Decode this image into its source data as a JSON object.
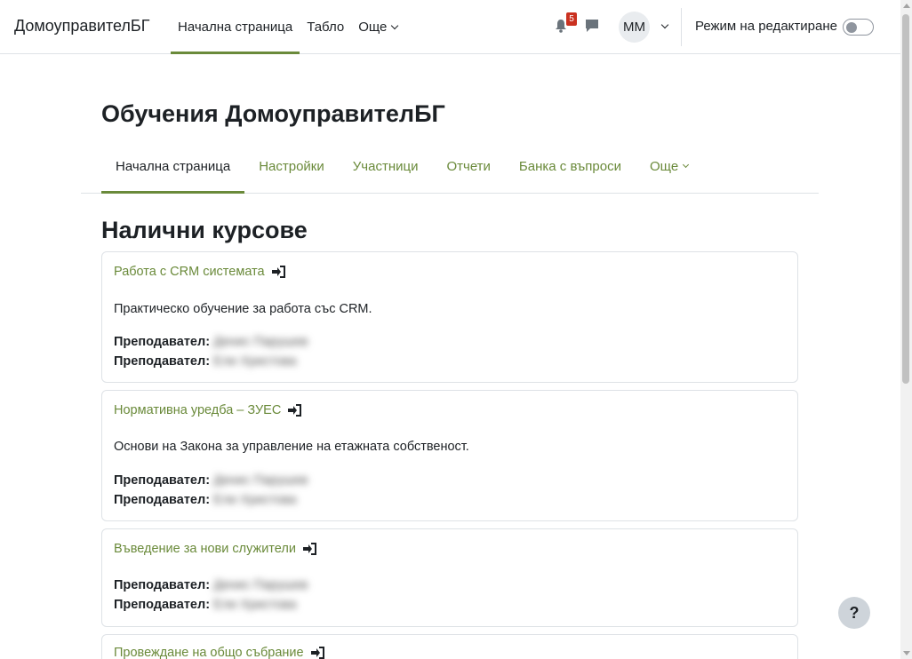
{
  "navbar": {
    "brand": "ДомоуправителБГ",
    "items": [
      {
        "label": "Начална страница",
        "active": true
      },
      {
        "label": "Табло",
        "active": false
      },
      {
        "label": "Още",
        "active": false
      }
    ],
    "notification_count": "5",
    "avatar_initials": "ММ",
    "edit_mode_label": "Режим на редактиране",
    "edit_mode_on": false
  },
  "site": {
    "title": "Обучения ДомоуправителБГ"
  },
  "secondary_nav": {
    "items": [
      {
        "label": "Начална страница",
        "active": true
      },
      {
        "label": "Настройки",
        "active": false
      },
      {
        "label": "Участници",
        "active": false
      },
      {
        "label": "Отчети",
        "active": false
      },
      {
        "label": "Банка с въпроси",
        "active": false
      },
      {
        "label": "Още",
        "active": false
      }
    ]
  },
  "courses_section": {
    "title": "Налични курсове",
    "teacher_label": "Преподавател:",
    "courses": [
      {
        "title": "Работа с CRM системата",
        "summary": "Практическо обучение за работа със CRM.",
        "teachers": [
          "Денис Парушев",
          "Ели Христова"
        ]
      },
      {
        "title": "Нормативна уредба – ЗУЕС",
        "summary": "Основи на Закона за управление на етажната собственост.",
        "teachers": [
          "Денис Парушев",
          "Ели Христова"
        ]
      },
      {
        "title": "Въведение за нови служители",
        "summary": "",
        "teachers": [
          "Денис Парушев",
          "Ели Христова"
        ]
      },
      {
        "title": "Провеждане на общо събрание",
        "summary": "",
        "teachers": []
      }
    ]
  },
  "help_button": "?",
  "colors": {
    "accent": "#6a8a3a",
    "text": "#1d2125",
    "border": "#dee2e6",
    "badge": "#ca3120"
  }
}
